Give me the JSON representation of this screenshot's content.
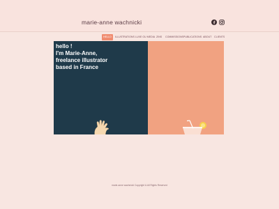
{
  "site": {
    "title": "marie-anne wachnicki"
  },
  "social": {
    "icons": [
      "facebook-icon",
      "instagram-icon"
    ]
  },
  "nav": {
    "items": [
      {
        "label": "HELLO",
        "active": true
      },
      {
        "label": "ILLUSTRATIONS"
      },
      {
        "label": "LUXE OU MEDIA"
      },
      {
        "label": "ZINS"
      },
      {
        "label": "COMMISSIONS"
      },
      {
        "label": "PUBLICATIONS"
      },
      {
        "label": "ABOUT"
      },
      {
        "label": "CLIENTS"
      }
    ]
  },
  "hero": {
    "lines": [
      "hello !",
      "I'm Marie-Anne,",
      "freelance illustrator",
      "based in France"
    ]
  },
  "footer": {
    "text": "marie-anne wachnicki Copyright & All Rights Reserved"
  },
  "colors": {
    "background": "#f8e6e1",
    "hero_left": "#1f3a4a",
    "hero_right": "#f1a281",
    "nav_active": "#f08c70",
    "title_text": "#5a3b44"
  }
}
